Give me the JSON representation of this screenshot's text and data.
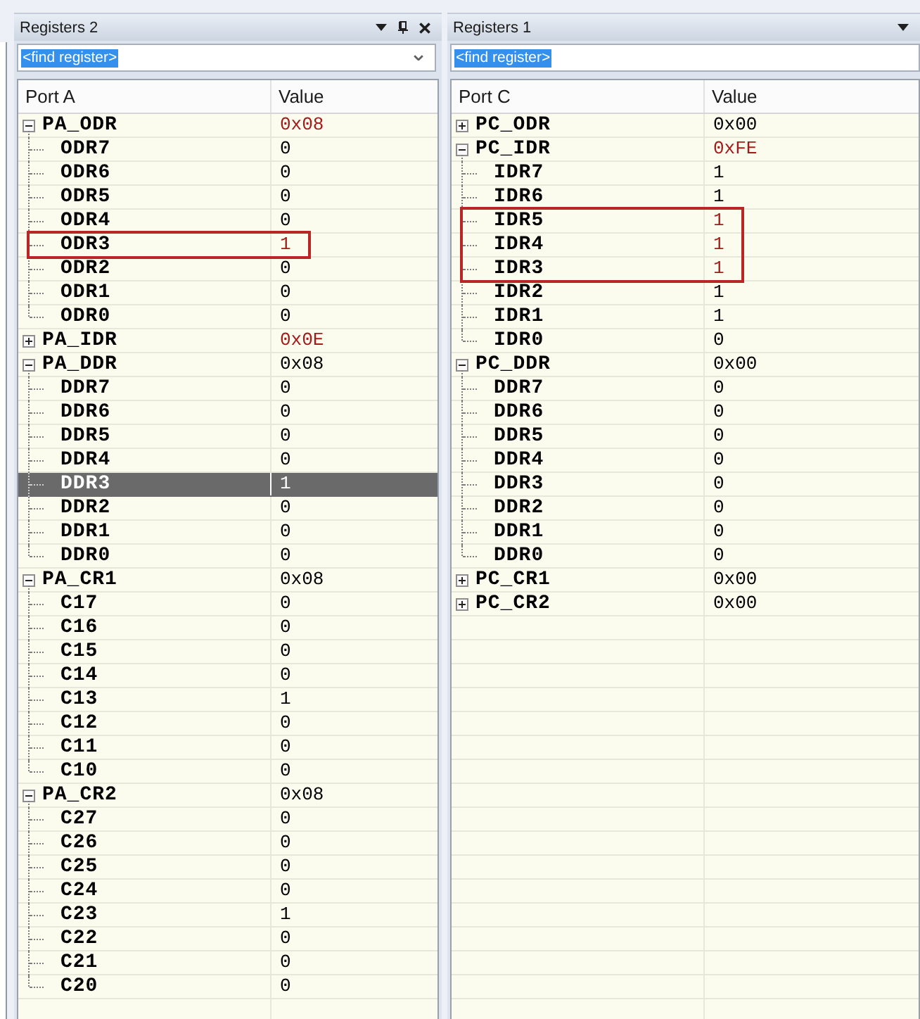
{
  "panels": [
    {
      "title": "Registers 2",
      "title_buttons": [
        {
          "kind": "menu"
        },
        {
          "kind": "pin"
        },
        {
          "kind": "close"
        }
      ],
      "find": {
        "value": "<find register>",
        "highlighted": true,
        "dropdown": true
      },
      "columns": [
        "Port A",
        "Value"
      ],
      "registers": [
        {
          "name": "PA_ODR",
          "value": "0x08",
          "changed": true,
          "expanded": true,
          "selected": false,
          "outlined": false,
          "children": [
            {
              "name": "ODR7",
              "value": "0",
              "changed": false,
              "selected": false,
              "outlined": false
            },
            {
              "name": "ODR6",
              "value": "0",
              "changed": false,
              "selected": false,
              "outlined": false
            },
            {
              "name": "ODR5",
              "value": "0",
              "changed": false,
              "selected": false,
              "outlined": false
            },
            {
              "name": "ODR4",
              "value": "0",
              "changed": false,
              "selected": false,
              "outlined": false
            },
            {
              "name": "ODR3",
              "value": "1",
              "changed": true,
              "selected": false,
              "outlined": true
            },
            {
              "name": "ODR2",
              "value": "0",
              "changed": false,
              "selected": false,
              "outlined": false
            },
            {
              "name": "ODR1",
              "value": "0",
              "changed": false,
              "selected": false,
              "outlined": false
            },
            {
              "name": "ODR0",
              "value": "0",
              "changed": false,
              "selected": false,
              "outlined": false
            }
          ]
        },
        {
          "name": "PA_IDR",
          "value": "0x0E",
          "changed": true,
          "expanded": false,
          "selected": false,
          "outlined": false
        },
        {
          "name": "PA_DDR",
          "value": "0x08",
          "changed": false,
          "expanded": true,
          "selected": false,
          "outlined": false,
          "children": [
            {
              "name": "DDR7",
              "value": "0",
              "changed": false,
              "selected": false,
              "outlined": false
            },
            {
              "name": "DDR6",
              "value": "0",
              "changed": false,
              "selected": false,
              "outlined": false
            },
            {
              "name": "DDR5",
              "value": "0",
              "changed": false,
              "selected": false,
              "outlined": false
            },
            {
              "name": "DDR4",
              "value": "0",
              "changed": false,
              "selected": false,
              "outlined": false
            },
            {
              "name": "DDR3",
              "value": "1",
              "changed": false,
              "selected": true,
              "outlined": false
            },
            {
              "name": "DDR2",
              "value": "0",
              "changed": false,
              "selected": false,
              "outlined": false
            },
            {
              "name": "DDR1",
              "value": "0",
              "changed": false,
              "selected": false,
              "outlined": false
            },
            {
              "name": "DDR0",
              "value": "0",
              "changed": false,
              "selected": false,
              "outlined": false
            }
          ]
        },
        {
          "name": "PA_CR1",
          "value": "0x08",
          "changed": false,
          "expanded": true,
          "selected": false,
          "outlined": false,
          "children": [
            {
              "name": "C17",
              "value": "0",
              "changed": false,
              "selected": false,
              "outlined": false
            },
            {
              "name": "C16",
              "value": "0",
              "changed": false,
              "selected": false,
              "outlined": false
            },
            {
              "name": "C15",
              "value": "0",
              "changed": false,
              "selected": false,
              "outlined": false
            },
            {
              "name": "C14",
              "value": "0",
              "changed": false,
              "selected": false,
              "outlined": false
            },
            {
              "name": "C13",
              "value": "1",
              "changed": false,
              "selected": false,
              "outlined": false
            },
            {
              "name": "C12",
              "value": "0",
              "changed": false,
              "selected": false,
              "outlined": false
            },
            {
              "name": "C11",
              "value": "0",
              "changed": false,
              "selected": false,
              "outlined": false
            },
            {
              "name": "C10",
              "value": "0",
              "changed": false,
              "selected": false,
              "outlined": false
            }
          ]
        },
        {
          "name": "PA_CR2",
          "value": "0x08",
          "changed": false,
          "expanded": true,
          "selected": false,
          "outlined": false,
          "children": [
            {
              "name": "C27",
              "value": "0",
              "changed": false,
              "selected": false,
              "outlined": false
            },
            {
              "name": "C26",
              "value": "0",
              "changed": false,
              "selected": false,
              "outlined": false
            },
            {
              "name": "C25",
              "value": "0",
              "changed": false,
              "selected": false,
              "outlined": false
            },
            {
              "name": "C24",
              "value": "0",
              "changed": false,
              "selected": false,
              "outlined": false
            },
            {
              "name": "C23",
              "value": "1",
              "changed": false,
              "selected": false,
              "outlined": false
            },
            {
              "name": "C22",
              "value": "0",
              "changed": false,
              "selected": false,
              "outlined": false
            },
            {
              "name": "C21",
              "value": "0",
              "changed": false,
              "selected": false,
              "outlined": false
            },
            {
              "name": "C20",
              "value": "0",
              "changed": false,
              "selected": false,
              "outlined": false
            }
          ]
        }
      ]
    },
    {
      "title": "Registers 1",
      "title_buttons": [
        {
          "kind": "menu"
        }
      ],
      "find": {
        "value": "<find register>",
        "highlighted": true,
        "dropdown": false
      },
      "columns": [
        "Port C",
        "Value"
      ],
      "registers": [
        {
          "name": "PC_ODR",
          "value": "0x00",
          "changed": false,
          "expanded": false,
          "selected": false,
          "outlined": false
        },
        {
          "name": "PC_IDR",
          "value": "0xFE",
          "changed": true,
          "expanded": true,
          "selected": false,
          "outlined": false,
          "children": [
            {
              "name": "IDR7",
              "value": "1",
              "changed": false,
              "selected": false,
              "outlined": false
            },
            {
              "name": "IDR6",
              "value": "1",
              "changed": false,
              "selected": false,
              "outlined": false
            },
            {
              "name": "IDR5",
              "value": "1",
              "changed": true,
              "selected": false,
              "outlined": true
            },
            {
              "name": "IDR4",
              "value": "1",
              "changed": true,
              "selected": false,
              "outlined": true
            },
            {
              "name": "IDR3",
              "value": "1",
              "changed": true,
              "selected": false,
              "outlined": true
            },
            {
              "name": "IDR2",
              "value": "1",
              "changed": false,
              "selected": false,
              "outlined": false
            },
            {
              "name": "IDR1",
              "value": "1",
              "changed": false,
              "selected": false,
              "outlined": false
            },
            {
              "name": "IDR0",
              "value": "0",
              "changed": false,
              "selected": false,
              "outlined": false
            }
          ]
        },
        {
          "name": "PC_DDR",
          "value": "0x00",
          "changed": false,
          "expanded": true,
          "selected": false,
          "outlined": false,
          "children": [
            {
              "name": "DDR7",
              "value": "0",
              "changed": false,
              "selected": false,
              "outlined": false
            },
            {
              "name": "DDR6",
              "value": "0",
              "changed": false,
              "selected": false,
              "outlined": false
            },
            {
              "name": "DDR5",
              "value": "0",
              "changed": false,
              "selected": false,
              "outlined": false
            },
            {
              "name": "DDR4",
              "value": "0",
              "changed": false,
              "selected": false,
              "outlined": false
            },
            {
              "name": "DDR3",
              "value": "0",
              "changed": false,
              "selected": false,
              "outlined": false
            },
            {
              "name": "DDR2",
              "value": "0",
              "changed": false,
              "selected": false,
              "outlined": false
            },
            {
              "name": "DDR1",
              "value": "0",
              "changed": false,
              "selected": false,
              "outlined": false
            },
            {
              "name": "DDR0",
              "value": "0",
              "changed": false,
              "selected": false,
              "outlined": false
            }
          ]
        },
        {
          "name": "PC_CR1",
          "value": "0x00",
          "changed": false,
          "expanded": false,
          "selected": false,
          "outlined": false
        },
        {
          "name": "PC_CR2",
          "value": "0x00",
          "changed": false,
          "expanded": false,
          "selected": false,
          "outlined": false
        }
      ]
    }
  ]
}
